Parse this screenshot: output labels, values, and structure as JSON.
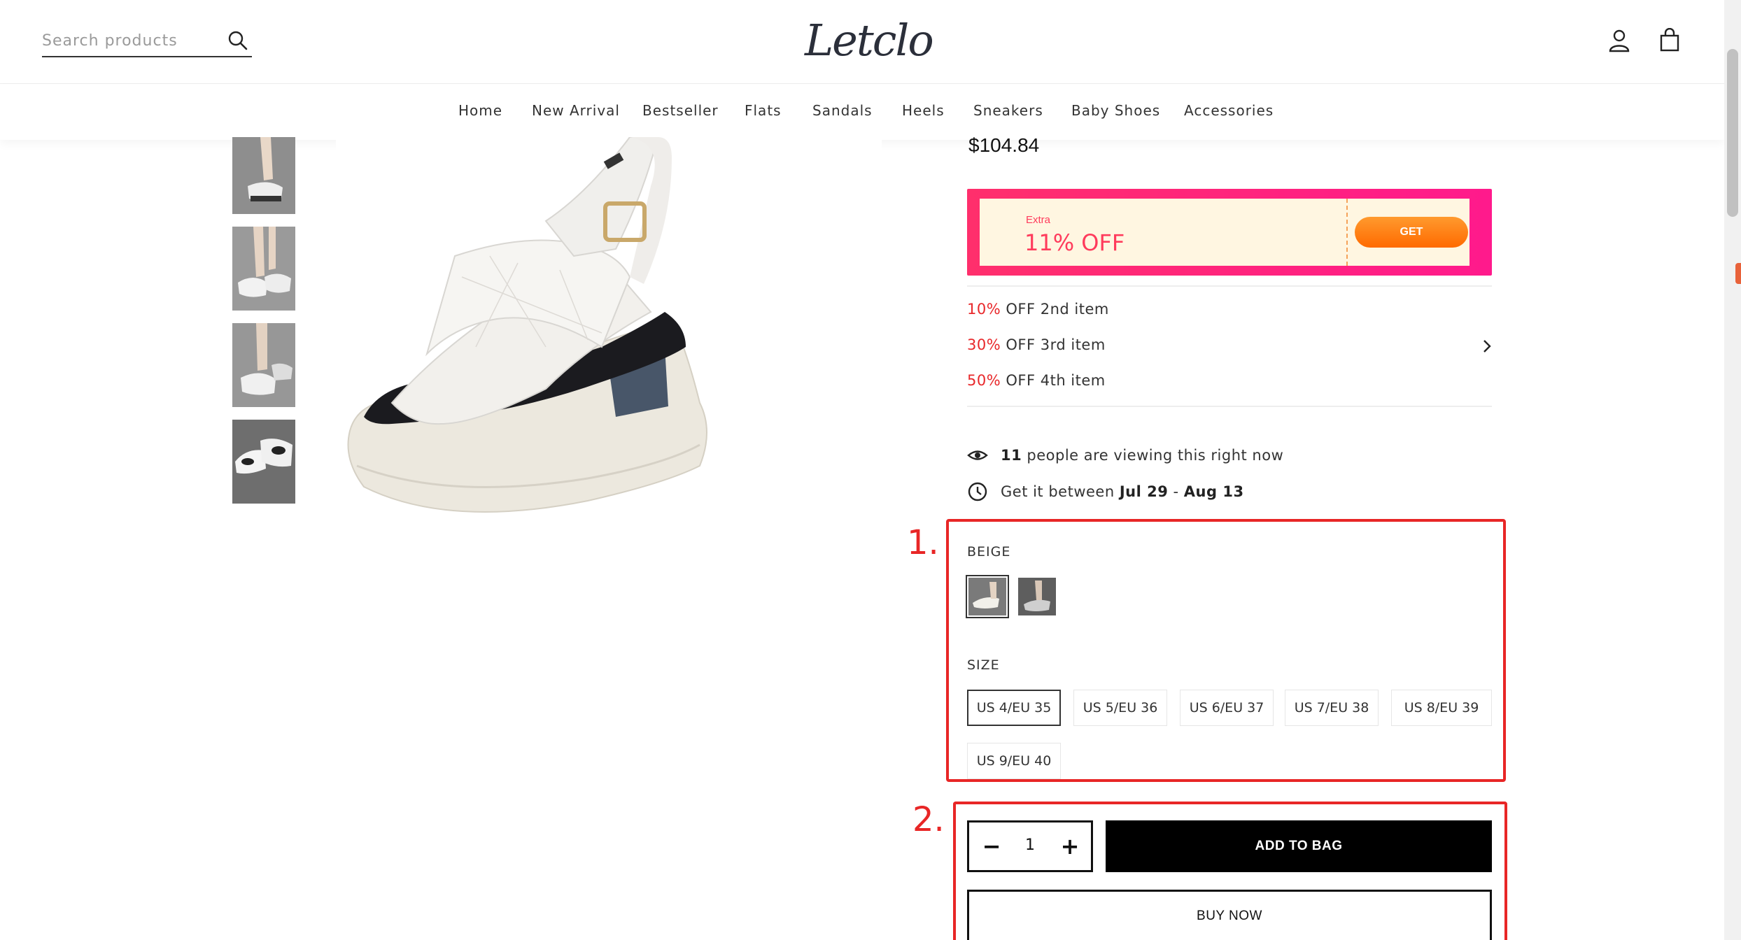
{
  "header": {
    "search_placeholder": "Search products",
    "logo_text": "Letclo",
    "icons": [
      "search-icon",
      "user-icon",
      "bag-icon"
    ]
  },
  "nav": {
    "items": [
      "Home",
      "New Arrival",
      "Bestseller",
      "Flats",
      "Sandals",
      "Heels",
      "Sneakers",
      "Baby Shoes",
      "Accessories"
    ]
  },
  "product": {
    "price": "$104.84",
    "coupon": {
      "extra_label": "Extra",
      "off_label": "11% OFF",
      "get_label": "GET"
    },
    "promos": [
      {
        "pct": "10%",
        "text": " OFF 2nd item"
      },
      {
        "pct": "30%",
        "text": " OFF 3rd item"
      },
      {
        "pct": "50%",
        "text": " OFF 4th item"
      }
    ],
    "viewers": {
      "count": "11",
      "text": " people are viewing this right now"
    },
    "delivery": {
      "prefix": "Get it between ",
      "start": "Jul 29",
      "sep": " - ",
      "end": "Aug 13"
    },
    "color_label": "BEIGE",
    "size_label": "SIZE",
    "sizes": [
      "US 4/EU 35",
      "US 5/EU 36",
      "US 6/EU 37",
      "US 7/EU 38",
      "US 8/EU 39",
      "US 9/EU 40"
    ],
    "selected_size": "US 4/EU 35",
    "quantity": "1",
    "qty_minus": "−",
    "qty_plus": "+",
    "add_to_bag": "ADD TO BAG",
    "buy_now": "BUY NOW"
  },
  "annotations": {
    "one": "1.",
    "two": "2."
  },
  "colors": {
    "accent_red": "#e8282b",
    "annotation_red": "#e82626",
    "coupon_pink": "#ff2f6c",
    "get_orange": "#ff7a10"
  }
}
